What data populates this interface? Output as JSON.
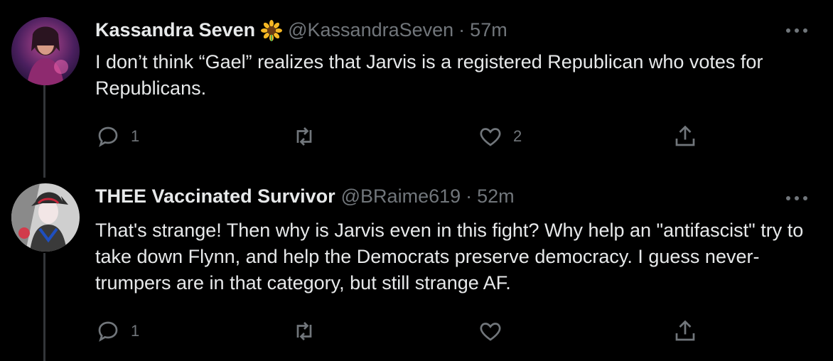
{
  "tweets": [
    {
      "name": "Kassandra Seven",
      "emoji_icon": "sunflower-emoji-icon",
      "handle": "@KassandraSeven",
      "separator": "·",
      "time": "57m",
      "text": "I don’t think “Gael” realizes that Jarvis is a registered Republican who votes for Republicans.",
      "replies": "1",
      "retweets": "",
      "likes": "2"
    },
    {
      "name": "THEE Vaccinated Survivor",
      "handle": "@BRaime619",
      "separator": "·",
      "time": "52m",
      "text": "That's strange! Then why is Jarvis even in this fight? Why help an \"antifascist\" try to take down Flynn, and help the Democrats preserve democracy. I guess never-trumpers are in that category, but still strange AF.",
      "replies": "1",
      "retweets": "",
      "likes": ""
    }
  ],
  "colors": {
    "background": "#000000",
    "primary_text": "#e7e9ea",
    "secondary_text": "#71767b",
    "thread_line": "#333639"
  }
}
